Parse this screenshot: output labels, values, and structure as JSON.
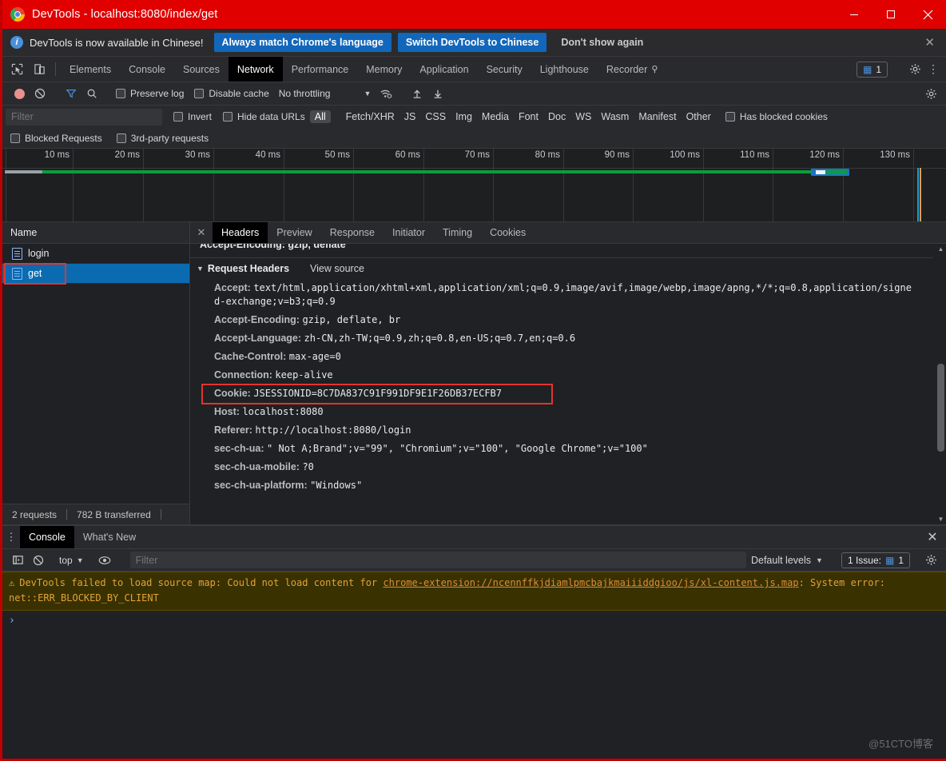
{
  "titlebar": {
    "title": "DevTools - localhost:8080/index/get",
    "logo_icon": "chrome-logo-icon",
    "minimize_icon": "minimize-icon",
    "maximize_icon": "maximize-icon",
    "close_icon": "close-icon"
  },
  "banner": {
    "info_icon": "info-icon",
    "message": "DevTools is now available in Chinese!",
    "primary_label": "Always match Chrome's language",
    "secondary_label": "Switch DevTools to Chinese",
    "dismiss_label": "Don't show again",
    "close_icon": "close-icon",
    "accent": "#1267ba"
  },
  "panel_tabs": {
    "inspect_icon": "inspect-element-icon",
    "device_icon": "device-toolbar-icon",
    "items": [
      {
        "label": "Elements",
        "active": false
      },
      {
        "label": "Console",
        "active": false
      },
      {
        "label": "Sources",
        "active": false
      },
      {
        "label": "Network",
        "active": true
      },
      {
        "label": "Performance",
        "active": false
      },
      {
        "label": "Memory",
        "active": false
      },
      {
        "label": "Application",
        "active": false
      },
      {
        "label": "Security",
        "active": false
      },
      {
        "label": "Lighthouse",
        "active": false
      },
      {
        "label": "Recorder",
        "active": false,
        "beaker": "⚲"
      }
    ],
    "issues_count": "1",
    "issues_icon": "message-icon",
    "settings_icon": "gear-icon",
    "more_icon": "kebab-menu-icon"
  },
  "network_toolbar": {
    "record_icon": "record-stop-icon",
    "clear_icon": "clear-icon",
    "filter_icon": "filter-funnel-icon",
    "search_icon": "search-icon",
    "preserve_log_label": "Preserve log",
    "preserve_log_checked": false,
    "disable_cache_label": "Disable cache",
    "disable_cache_checked": false,
    "throttling_label": "No throttling",
    "throttling_caret": "▼",
    "wifi_icon": "network-conditions-icon",
    "import_icon": "import-har-icon",
    "export_icon": "export-har-icon",
    "settings_icon": "gear-icon"
  },
  "filter_bar": {
    "filter_placeholder": "Filter",
    "filter_value": "",
    "invert_label": "Invert",
    "invert_checked": false,
    "hide_data_urls_label": "Hide data URLs",
    "hide_data_urls_checked": false,
    "types": [
      {
        "label": "All",
        "active": true
      },
      {
        "label": "Fetch/XHR",
        "active": false
      },
      {
        "label": "JS",
        "active": false
      },
      {
        "label": "CSS",
        "active": false
      },
      {
        "label": "Img",
        "active": false
      },
      {
        "label": "Media",
        "active": false
      },
      {
        "label": "Font",
        "active": false
      },
      {
        "label": "Doc",
        "active": false
      },
      {
        "label": "WS",
        "active": false
      },
      {
        "label": "Wasm",
        "active": false
      },
      {
        "label": "Manifest",
        "active": false
      },
      {
        "label": "Other",
        "active": false
      }
    ],
    "has_blocked_cookies_label": "Has blocked cookies",
    "has_blocked_cookies_checked": false,
    "blocked_requests_label": "Blocked Requests",
    "blocked_requests_checked": false,
    "third_party_label": "3rd-party requests",
    "third_party_checked": false
  },
  "overview": {
    "ticks": [
      "10 ms",
      "20 ms",
      "30 ms",
      "40 ms",
      "50 ms",
      "60 ms",
      "70 ms",
      "80 ms",
      "90 ms",
      "100 ms",
      "110 ms",
      "120 ms",
      "130 ms"
    ]
  },
  "requests": {
    "column_header": "Name",
    "rows": [
      {
        "name": "login",
        "icon": "document-icon",
        "selected": false
      },
      {
        "name": "get",
        "icon": "document-icon",
        "selected": true
      }
    ],
    "status_count": "2 requests",
    "status_transferred": "782 B transferred"
  },
  "details": {
    "close_icon": "close-icon",
    "tabs": [
      {
        "label": "Headers",
        "active": true
      },
      {
        "label": "Preview",
        "active": false
      },
      {
        "label": "Response",
        "active": false
      },
      {
        "label": "Initiator",
        "active": false
      },
      {
        "label": "Timing",
        "active": false
      },
      {
        "label": "Cookies",
        "active": false
      }
    ],
    "clipped_line": "Accept-Encoding: gzip, deflate",
    "section_title": "Request Headers",
    "view_source_label": "View source",
    "headers": [
      {
        "key": "Accept:",
        "value": "text/html,application/xhtml+xml,application/xml;q=0.9,image/avif,image/webp,image/apng,*/*;q=0.8,application/signed-exchange;v=b3;q=0.9",
        "highlight": false
      },
      {
        "key": "Accept-Encoding:",
        "value": "gzip, deflate, br",
        "highlight": false
      },
      {
        "key": "Accept-Language:",
        "value": "zh-CN,zh-TW;q=0.9,zh;q=0.8,en-US;q=0.7,en;q=0.6",
        "highlight": false
      },
      {
        "key": "Cache-Control:",
        "value": "max-age=0",
        "highlight": false
      },
      {
        "key": "Connection:",
        "value": "keep-alive",
        "highlight": false
      },
      {
        "key": "Cookie:",
        "value": "JSESSIONID=8C7DA837C91F991DF9E1F26DB37ECFB7",
        "highlight": true
      },
      {
        "key": "Host:",
        "value": "localhost:8080",
        "highlight": false
      },
      {
        "key": "Referer:",
        "value": "http://localhost:8080/login",
        "highlight": false
      },
      {
        "key": "sec-ch-ua:",
        "value": "\" Not A;Brand\";v=\"99\", \"Chromium\";v=\"100\", \"Google Chrome\";v=\"100\"",
        "highlight": false
      },
      {
        "key": "sec-ch-ua-mobile:",
        "value": "?0",
        "highlight": false
      },
      {
        "key": "sec-ch-ua-platform:",
        "value": "\"Windows\"",
        "highlight": false
      }
    ]
  },
  "drawer": {
    "more_icon": "kebab-menu-icon",
    "tabs": [
      {
        "label": "Console",
        "active": true
      },
      {
        "label": "What's New",
        "active": false
      }
    ],
    "close_icon": "close-icon",
    "toolbar": {
      "sidebar_icon": "console-sidebar-icon",
      "clear_icon": "clear-console-icon",
      "context_label": "top",
      "context_caret": "▼",
      "eye_icon": "live-expression-icon",
      "filter_placeholder": "Filter",
      "filter_value": "",
      "levels_label": "Default levels",
      "levels_caret": "▼",
      "issue_label": "1 Issue:",
      "issue_count": "1",
      "issue_icon": "message-icon",
      "settings_icon": "gear-icon"
    },
    "messages": [
      {
        "level": "warning",
        "icon": "warning-triangle-icon",
        "text_before": "DevTools failed to load source map: Could not load content for ",
        "link": "chrome-extension://ncennffkjdiamlpmcbajkmaiiiddgioo/js/xl-content.js.map",
        "text_after": ": System error: net::ERR_BLOCKED_BY_CLIENT"
      }
    ],
    "prompt_symbol": "›"
  },
  "watermark": "@51CTO博客",
  "colors": {
    "title_bar": "#e00000",
    "accent_blue": "#1267ba",
    "selection_blue": "#0b6bb0",
    "highlight_red": "#e3342f",
    "timeline_green": "#0a9e3f"
  }
}
